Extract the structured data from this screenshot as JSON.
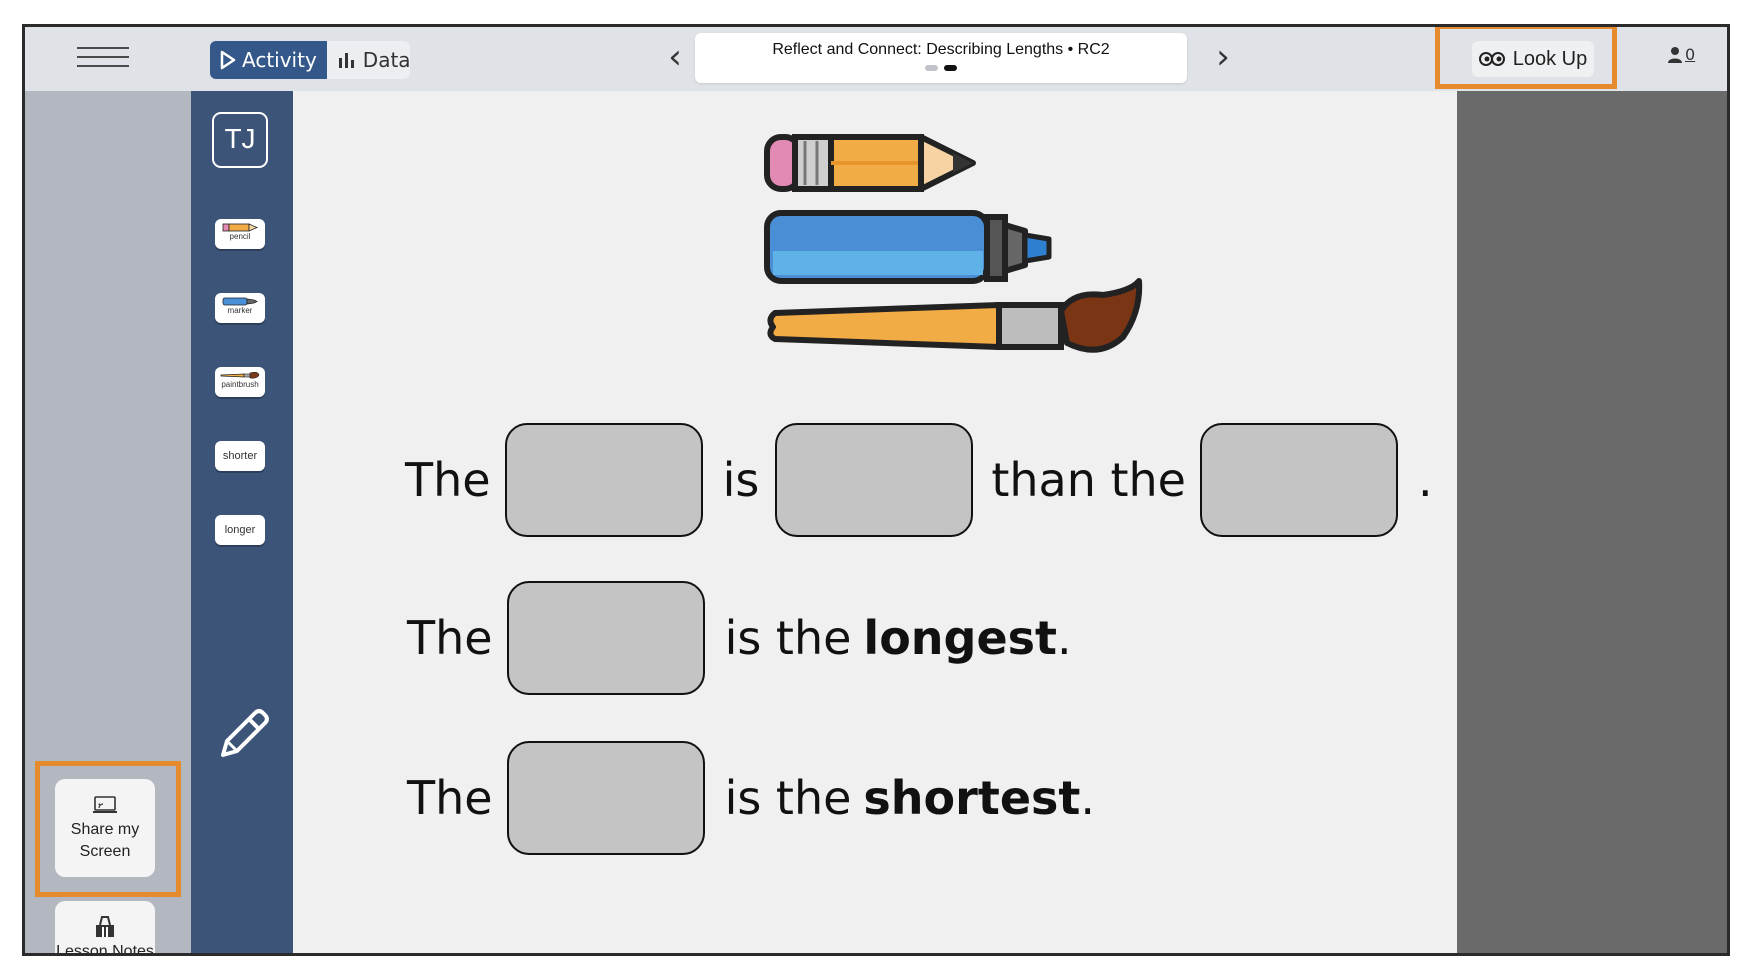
{
  "header": {
    "modes": [
      {
        "label": "Activity",
        "icon": "play-icon"
      },
      {
        "label": "Data",
        "icon": "bar-chart-icon"
      }
    ],
    "title": "Reflect and Connect: Describing Lengths • RC2",
    "lookup_label": "Look Up",
    "user_count": "0"
  },
  "sidebar": {
    "share_label": "Share my Screen",
    "notes_label": "Lesson Notes"
  },
  "toolbar": {
    "avatar": "TJ",
    "chips": [
      {
        "label": "pencil",
        "icon": "pencil-icon"
      },
      {
        "label": "marker",
        "icon": "marker-icon"
      },
      {
        "label": "paintbrush",
        "icon": "paintbrush-icon"
      },
      {
        "label": "shorter"
      },
      {
        "label": "longer"
      }
    ]
  },
  "sentences": {
    "s1_the": "The",
    "s1_is": "is",
    "s1_than": "than the",
    "s1_end": ".",
    "s2_the": "The",
    "s2_is_the": "is the",
    "s2_word": "longest",
    "s2_end": ".",
    "s3_the": "The",
    "s3_is_the": "is the",
    "s3_word": "shortest",
    "s3_end": "."
  },
  "colors": {
    "accent": "#e68a2e",
    "toolbar": "#3c5478",
    "active_mode": "#34588a"
  }
}
